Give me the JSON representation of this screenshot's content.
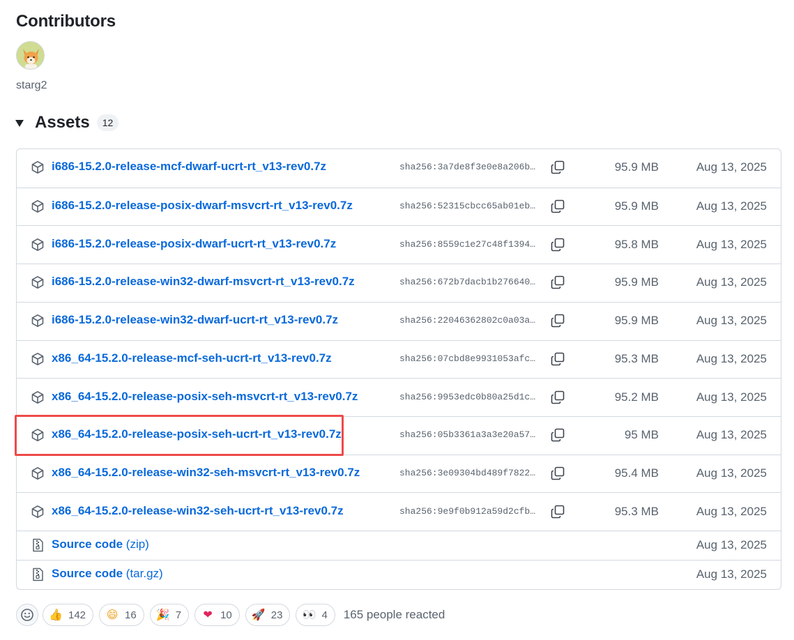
{
  "contributors": {
    "title": "Contributors",
    "users": [
      {
        "name": "starg2",
        "avatar": "fox-avatar-icon"
      }
    ]
  },
  "assets": {
    "title": "Assets",
    "count": "12",
    "items": [
      {
        "name": "i686-15.2.0-release-mcf-dwarf-ucrt-rt_v13-rev0.7z",
        "sha": "sha256:3a7de8f3e0e8a206b…",
        "size": "95.9 MB",
        "date": "Aug 13, 2025"
      },
      {
        "name": "i686-15.2.0-release-posix-dwarf-msvcrt-rt_v13-rev0.7z",
        "sha": "sha256:52315cbcc65ab01eb…",
        "size": "95.9 MB",
        "date": "Aug 13, 2025"
      },
      {
        "name": "i686-15.2.0-release-posix-dwarf-ucrt-rt_v13-rev0.7z",
        "sha": "sha256:8559c1e27c48f1394…",
        "size": "95.8 MB",
        "date": "Aug 13, 2025"
      },
      {
        "name": "i686-15.2.0-release-win32-dwarf-msvcrt-rt_v13-rev0.7z",
        "sha": "sha256:672b7dacb1b276640…",
        "size": "95.9 MB",
        "date": "Aug 13, 2025"
      },
      {
        "name": "i686-15.2.0-release-win32-dwarf-ucrt-rt_v13-rev0.7z",
        "sha": "sha256:22046362802c0a03a…",
        "size": "95.9 MB",
        "date": "Aug 13, 2025"
      },
      {
        "name": "x86_64-15.2.0-release-mcf-seh-ucrt-rt_v13-rev0.7z",
        "sha": "sha256:07cbd8e9931053afc…",
        "size": "95.3 MB",
        "date": "Aug 13, 2025"
      },
      {
        "name": "x86_64-15.2.0-release-posix-seh-msvcrt-rt_v13-rev0.7z",
        "sha": "sha256:9953edc0b80a25d1c…",
        "size": "95.2 MB",
        "date": "Aug 13, 2025"
      },
      {
        "name": "x86_64-15.2.0-release-posix-seh-ucrt-rt_v13-rev0.7z",
        "sha": "sha256:05b3361a3a3e20a57…",
        "size": "95 MB",
        "date": "Aug 13, 2025"
      },
      {
        "name": "x86_64-15.2.0-release-win32-seh-msvcrt-rt_v13-rev0.7z",
        "sha": "sha256:3e09304bd489f7822…",
        "size": "95.4 MB",
        "date": "Aug 13, 2025"
      },
      {
        "name": "x86_64-15.2.0-release-win32-seh-ucrt-rt_v13-rev0.7z",
        "sha": "sha256:9e9f0b912a59d2cfb…",
        "size": "95.3 MB",
        "date": "Aug 13, 2025"
      }
    ],
    "source": [
      {
        "label": "Source code",
        "suffix": "(zip)",
        "date": "Aug 13, 2025"
      },
      {
        "label": "Source code",
        "suffix": "(tar.gz)",
        "date": "Aug 13, 2025"
      }
    ]
  },
  "reactions": {
    "items": [
      {
        "emoji": "👍",
        "icon": "thumbs-up-icon",
        "count": "142"
      },
      {
        "emoji": "😄",
        "icon": "laugh-icon",
        "count": "16"
      },
      {
        "emoji": "🎉",
        "icon": "hooray-icon",
        "count": "7"
      },
      {
        "emoji": "❤",
        "icon": "heart-icon",
        "count": "10"
      },
      {
        "emoji": "🚀",
        "icon": "rocket-icon",
        "count": "23"
      },
      {
        "emoji": "👀",
        "icon": "eyes-icon",
        "count": "4"
      }
    ],
    "summary": "165 people reacted"
  },
  "colors": {
    "link": "#0969da",
    "muted": "#59636e",
    "border": "#d1d9e0",
    "highlight": "#ef4a4a"
  }
}
